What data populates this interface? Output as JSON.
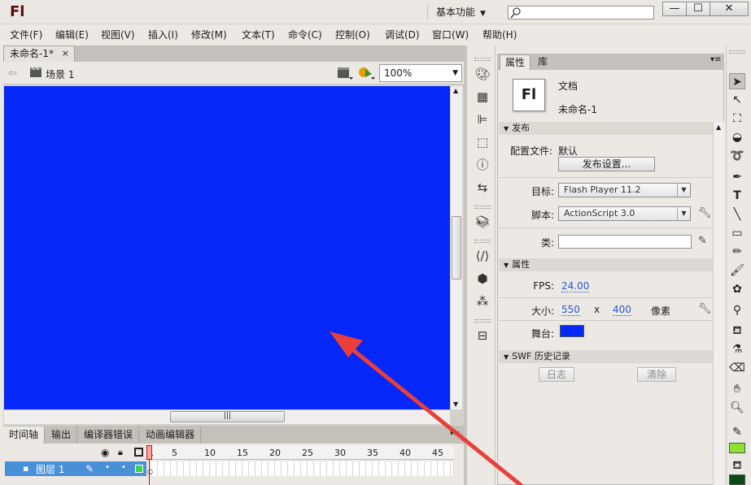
{
  "app": {
    "logo": "Fl",
    "workspace": "基本功能",
    "window_buttons": {
      "minimize": "—",
      "maximize": "☐",
      "close": "✕"
    }
  },
  "menu": [
    "文件(F)",
    "编辑(E)",
    "视图(V)",
    "插入(I)",
    "修改(M)",
    "文本(T)",
    "命令(C)",
    "控制(O)",
    "调试(D)",
    "窗口(W)",
    "帮助(H)"
  ],
  "document": {
    "tab": "未命名-1*",
    "tab_close": "×",
    "scene": "场景 1",
    "zoom": "100%",
    "stage_color": "#0527F7"
  },
  "timeline": {
    "tabs": [
      "时间轴",
      "输出",
      "编译器错误",
      "动画编辑器"
    ],
    "ruler": [
      "1",
      "5",
      "10",
      "15",
      "20",
      "25",
      "30",
      "35",
      "40",
      "45"
    ],
    "layer": "图层 1",
    "current_frame": 1
  },
  "panel": {
    "tabs": [
      "属性",
      "库"
    ],
    "doc_type": "文档",
    "doc_name": "未命名-1",
    "publish": {
      "header": "发布",
      "profile_label": "配置文件:",
      "profile_value": "默认",
      "settings_button": "发布设置...",
      "target_label": "目标:",
      "target_value": "Flash Player 11.2",
      "script_label": "脚本:",
      "script_value": "ActionScript 3.0",
      "class_label": "类:",
      "class_value": ""
    },
    "properties": {
      "header": "属性",
      "fps_label": "FPS:",
      "fps_value": "24.00",
      "size_label": "大小:",
      "width": "550",
      "x_sep": "x",
      "height": "400",
      "unit": "像素",
      "stage_label": "舞台:",
      "stage_color": "#0527F7"
    },
    "swf_history": {
      "header": "SWF 历史记录",
      "log_button": "日志",
      "clear_button": "清除"
    }
  },
  "tools": {
    "stroke_color": "#8FE030",
    "fill_color": "#0B4A17"
  },
  "annotation": {
    "arrow_color": "#E8403A"
  }
}
